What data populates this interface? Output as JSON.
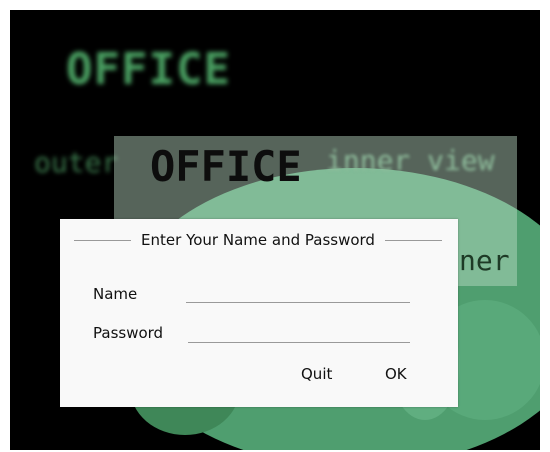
{
  "background": {
    "title": "OFFICE",
    "outer_label": "outer",
    "inner_view_label": "inner view"
  },
  "inner_view": {
    "title": "OFFICE",
    "partial_label": "ner"
  },
  "dialog": {
    "title": "Enter Your Name and Password",
    "name_label": "Name",
    "name_value": "",
    "password_label": "Password",
    "password_value": "",
    "quit_label": "Quit",
    "ok_label": "OK"
  }
}
